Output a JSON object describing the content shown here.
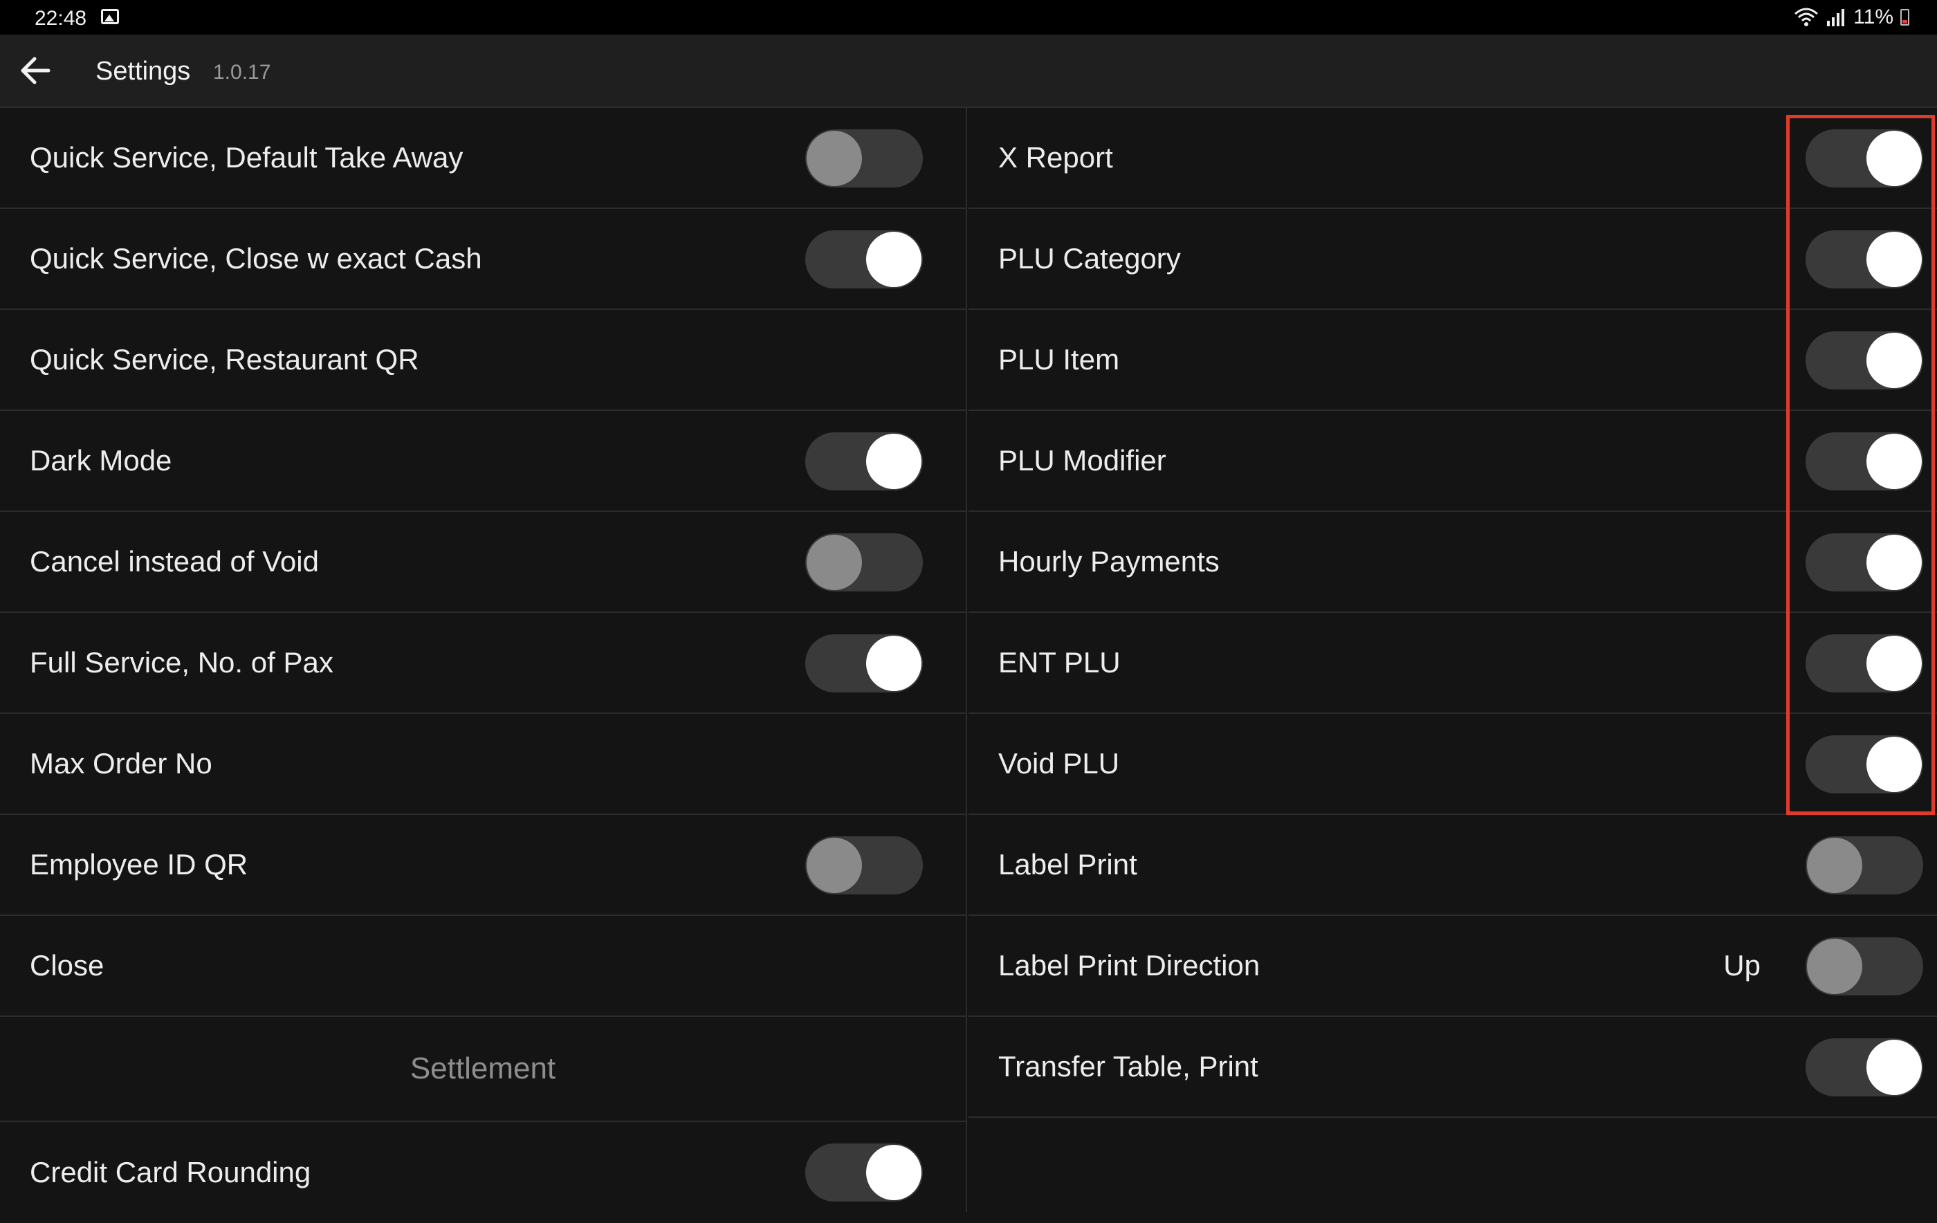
{
  "status_bar": {
    "time": "22:48",
    "battery_text": "11%",
    "icons": [
      "image-icon",
      "wifi-icon",
      "signal-icon",
      "battery-icon"
    ]
  },
  "app_bar": {
    "back_icon": "arrow-left-icon",
    "title": "Settings",
    "version": "1.0.17"
  },
  "left_column": [
    {
      "label": "Quick Service, Default Take Away",
      "toggle": false
    },
    {
      "label": "Quick Service, Close w exact Cash",
      "toggle": true
    },
    {
      "label": "Quick Service, Restaurant QR"
    },
    {
      "label": "Dark Mode",
      "toggle": true
    },
    {
      "label": "Cancel instead of Void",
      "toggle": false
    },
    {
      "label": "Full Service, No. of Pax",
      "toggle": true
    },
    {
      "label": "Max Order No"
    },
    {
      "label": "Employee ID QR",
      "toggle": false
    },
    {
      "label": "Close"
    },
    {
      "section": "Settlement"
    },
    {
      "label": "Credit Card Rounding",
      "toggle": true
    }
  ],
  "right_column": [
    {
      "label": "X Report",
      "toggle": true
    },
    {
      "label": "PLU Category",
      "toggle": true
    },
    {
      "label": "PLU Item",
      "toggle": true
    },
    {
      "label": "PLU Modifier",
      "toggle": true
    },
    {
      "label": "Hourly Payments",
      "toggle": true
    },
    {
      "label": "ENT PLU",
      "toggle": true
    },
    {
      "label": "Void PLU",
      "toggle": true
    },
    {
      "label": "Label Print",
      "toggle": false
    },
    {
      "label": "Label Print Direction",
      "value": "Up",
      "toggle": false
    },
    {
      "label": "Transfer Table, Print",
      "toggle": true
    }
  ],
  "colors": {
    "background": "#141414",
    "app_bar": "#1f1f1f",
    "toggle_track": "#3a3a3a",
    "toggle_knob_on": "#ffffff",
    "toggle_knob_off": "#8a8a8a",
    "highlight": "#e03a2a"
  }
}
